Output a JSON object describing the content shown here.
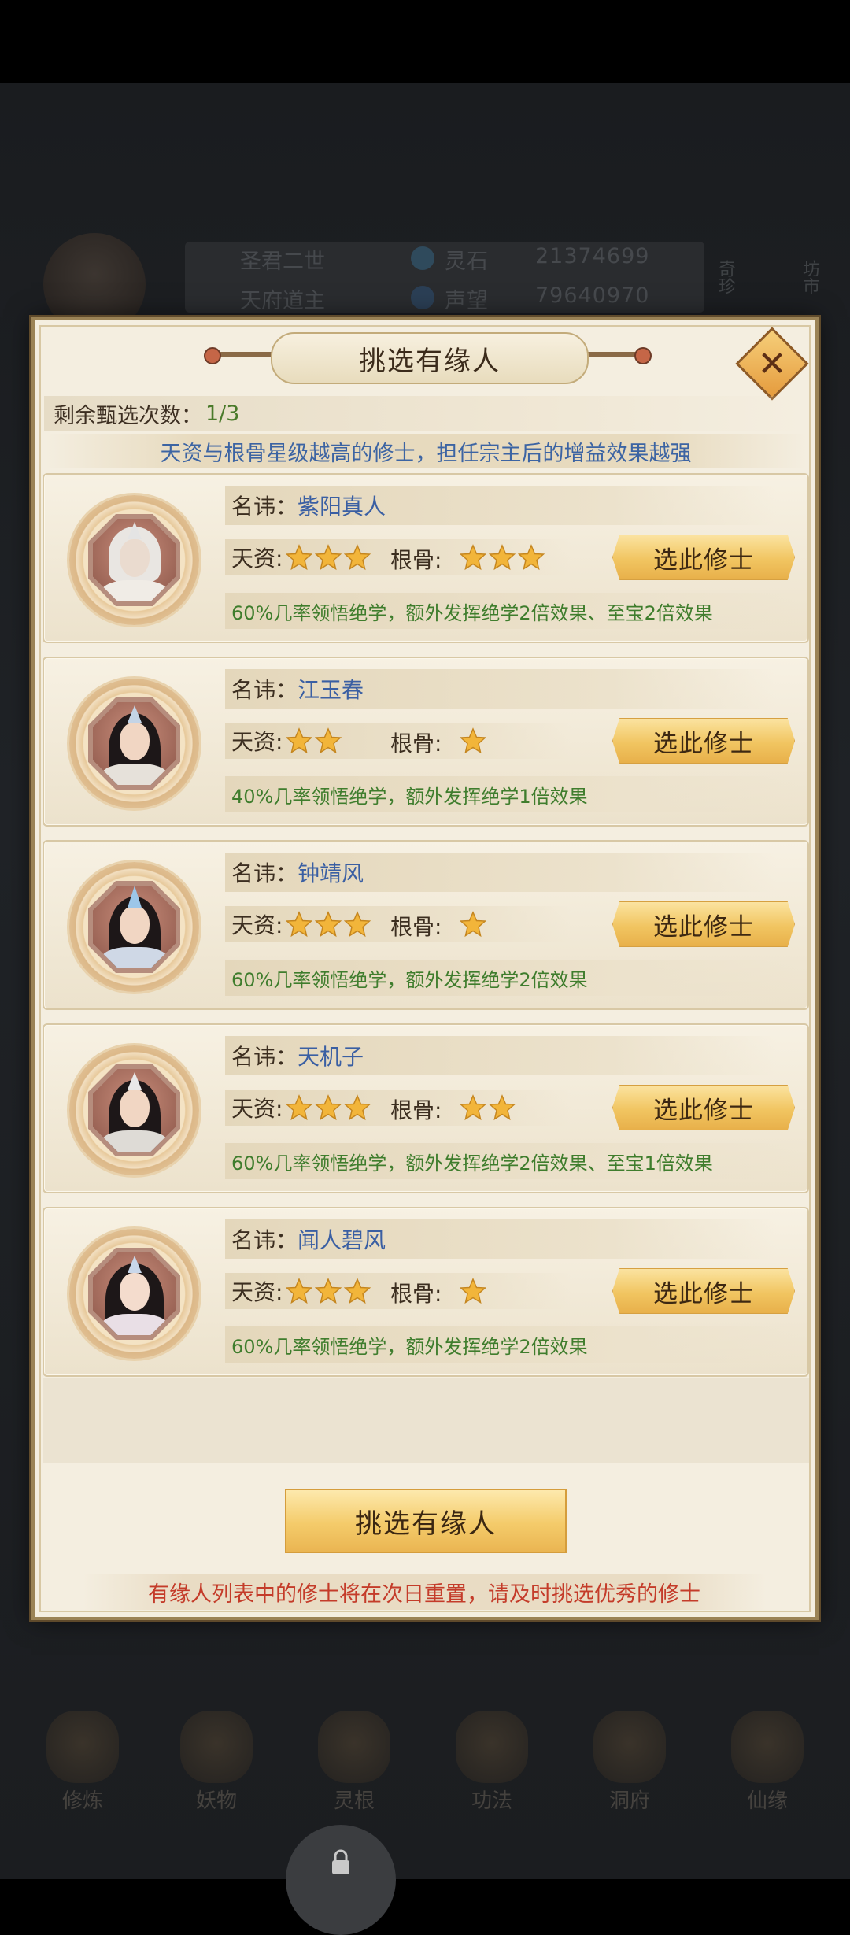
{
  "background_hud": {
    "player_name": "圣君二世",
    "player_title": "天府道主",
    "spirit_stone_label": "灵石",
    "spirit_stone_value": "21374699",
    "prestige_label": "声望",
    "prestige_value": "79640970",
    "side_tabs": [
      "奇珍",
      "坊市"
    ],
    "bottom_menu": [
      "修炼",
      "妖物",
      "灵根",
      "功法",
      "洞府",
      "仙缘"
    ]
  },
  "dialog": {
    "title": "挑选有缘人",
    "remaining_label": "剩余甄选次数：",
    "remaining_value": "1/3",
    "hint": "天资与根骨星级越高的修士，担任宗主后的增益效果越强",
    "name_label": "名讳：",
    "aptitude_label": "天资:",
    "bone_label": "根骨:",
    "pick_button_label": "选此修士",
    "cultivators": [
      {
        "name": "紫阳真人",
        "aptitude_stars": 3,
        "bone_stars": 3,
        "effect": "60%几率领悟绝学，额外发挥绝学2倍效果、至宝2倍效果",
        "portrait": "white-haired-elder"
      },
      {
        "name": "江玉春",
        "aptitude_stars": 2,
        "bone_stars": 1,
        "effect": "40%几率领悟绝学，额外发挥绝学1倍效果",
        "portrait": "young-swordsman"
      },
      {
        "name": "钟靖风",
        "aptitude_stars": 3,
        "bone_stars": 1,
        "effect": "60%几率领悟绝学，额外发挥绝学2倍效果",
        "portrait": "young-swordsman-crown"
      },
      {
        "name": "天机子",
        "aptitude_stars": 3,
        "bone_stars": 2,
        "effect": "60%几率领悟绝学，额外发挥绝学2倍效果、至宝1倍效果",
        "portrait": "bearded-daoist"
      },
      {
        "name": "闻人碧风",
        "aptitude_stars": 3,
        "bone_stars": 1,
        "effect": "60%几率领悟绝学，额外发挥绝学2倍效果",
        "portrait": "female-cultivator"
      }
    ],
    "main_button_label": "挑选有缘人",
    "reset_note": "有缘人列表中的修士将在次日重置，请及时挑选优秀的修士"
  },
  "colors": {
    "name_blue": "#3a5fa3",
    "effect_green": "#3f7d2d",
    "warning_red": "#c43c2a",
    "button_gold": "#f1c561"
  }
}
